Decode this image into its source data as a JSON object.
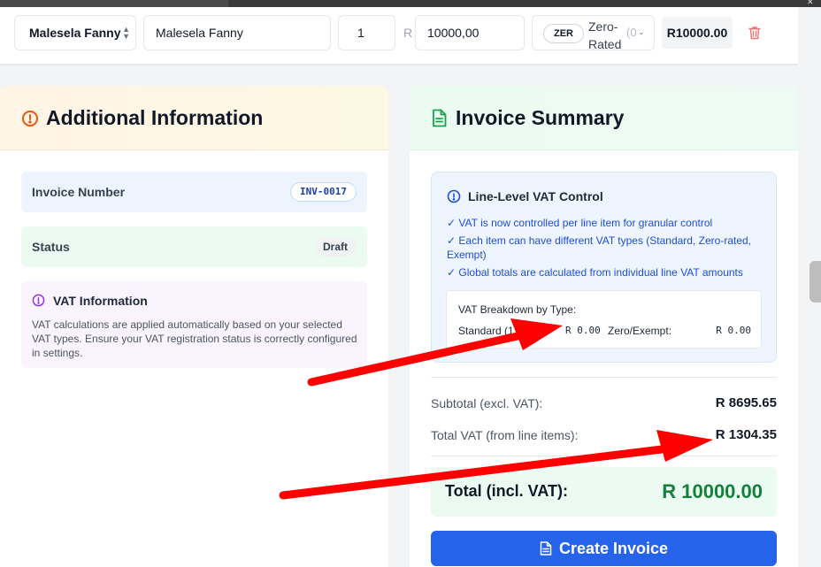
{
  "line_item": {
    "customer": "Malesela Fanny",
    "description": "Malesela Fanny",
    "quantity": "1",
    "currency": "R",
    "unit_price": "10000,00",
    "vat_badge": "ZER",
    "vat_type_label": "Zero-Rated",
    "vat_type_suffix": "(0",
    "line_total": "R10000.00"
  },
  "additional_info": {
    "title": "Additional Information",
    "invoice_number_label": "Invoice Number",
    "invoice_number": "INV-0017",
    "status_label": "Status",
    "status": "Draft",
    "vat_info_title": "VAT Information",
    "vat_info_text": "VAT calculations are applied automatically based on your selected VAT types. Ensure your VAT registration status is correctly configured in settings."
  },
  "summary": {
    "title": "Invoice Summary",
    "vat_control_title": "Line-Level VAT Control",
    "vat_control_points": [
      "✓ VAT is now controlled per line item for granular control",
      "✓ Each item can have different VAT types (Standard, Zero-rated, Exempt)",
      "✓ Global totals are calculated from individual line VAT amounts"
    ],
    "breakdown_title": "VAT Breakdown by Type:",
    "standard_label": "Standard (15%):",
    "standard_value": "R 0.00",
    "zero_label": "Zero/Exempt:",
    "zero_value": "R 0.00",
    "subtotal_label": "Subtotal (excl. VAT):",
    "subtotal_value": "R 8695.65",
    "total_vat_label": "Total VAT (from line items):",
    "total_vat_value": "R 1304.35",
    "total_label": "Total (incl. VAT):",
    "total_value": "R 10000.00",
    "create_button": "Create Invoice"
  },
  "colors": {
    "primary": "#2563eb",
    "total_green": "#15803d",
    "annotation_red": "#ff0000"
  },
  "icons": {
    "additional_info": "alert-circle-icon",
    "summary": "file-text-icon",
    "vat_info": "alert-circle-icon",
    "delete": "trash-icon",
    "create": "file-text-icon"
  }
}
